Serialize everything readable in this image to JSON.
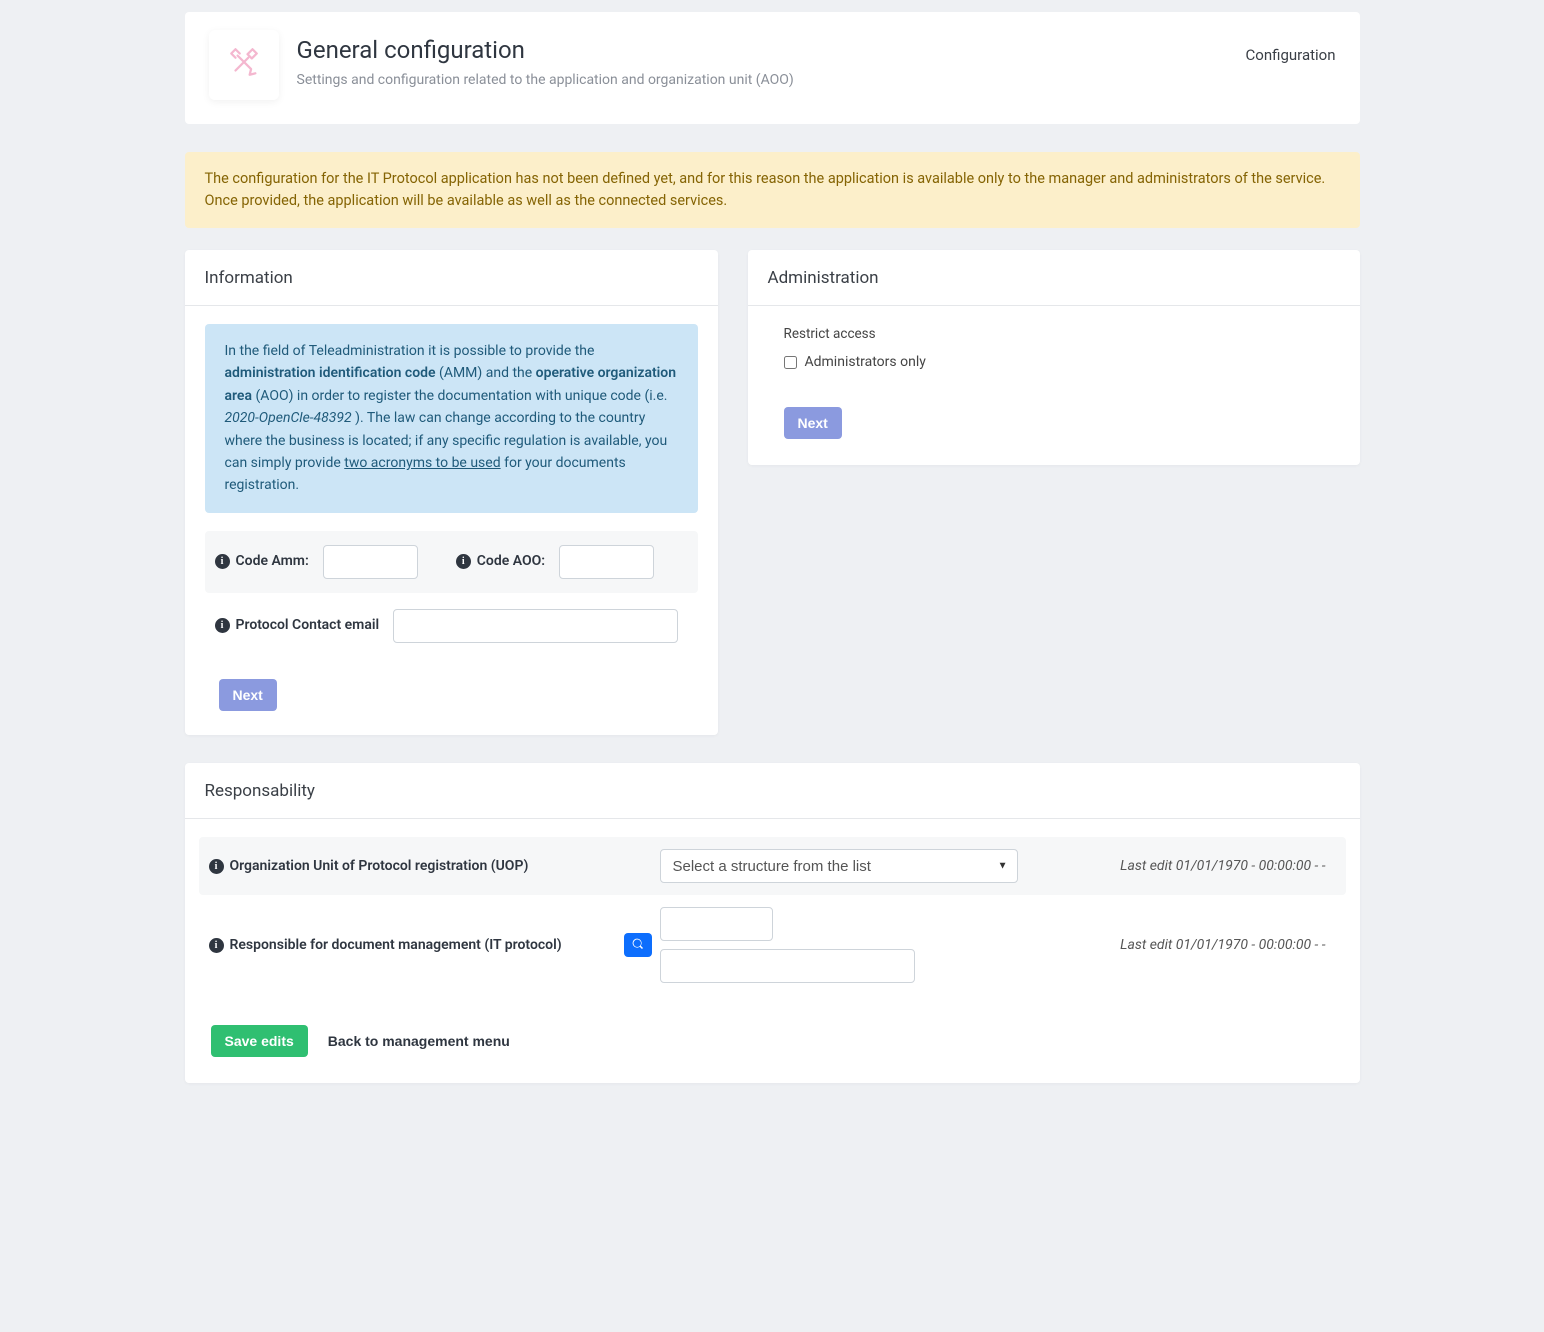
{
  "header": {
    "title": "General configuration",
    "subtitle": "Settings and configuration related to the application and organization unit (AOO)",
    "breadcrumb": "Configuration"
  },
  "alert": {
    "text": "The configuration for the IT Protocol application has not been defined yet, and for this reason the application is available only to the manager and administrators of the service. Once provided, the application will be available as well as the connected services."
  },
  "information": {
    "title": "Information",
    "callout": {
      "t1": "In the field of ",
      "link1": "Teleadministration",
      "t2": " it is possible to provide the ",
      "b1": "administration identification code",
      "t3": " (AMM) and the ",
      "b2": "operative organization area",
      "t4": " (AOO) in order to register the documentation with unique code (i.e. ",
      "i1": "2020-OpenCle-48392",
      "t5": "). The law can change according to the country where the business is located; if any specific regulation is available, you can simply provide ",
      "link2": "two acronyms to be used",
      "t6": " for your documents registration."
    },
    "code_amm_label": "Code Amm:",
    "code_aoo_label": "Code AOO:",
    "contact_email_label": "Protocol Contact email",
    "next_label": "Next"
  },
  "administration": {
    "title": "Administration",
    "restrict_label": "Restrict access",
    "admins_only_label": "Administrators only",
    "next_label": "Next"
  },
  "responsibility": {
    "title": "Responsability",
    "uop_label": "Organization Unit of Protocol registration (UOP)",
    "select_placeholder": "Select a structure from the list",
    "last_edit_uop": "Last edit 01/01/1970 - 00:00:00 - -",
    "resp_doc_label": "Responsible for document management (IT protocol)",
    "last_edit_resp": "Last edit 01/01/1970 - 00:00:00 - -",
    "save_label": "Save edits",
    "back_label": "Back to management menu"
  }
}
